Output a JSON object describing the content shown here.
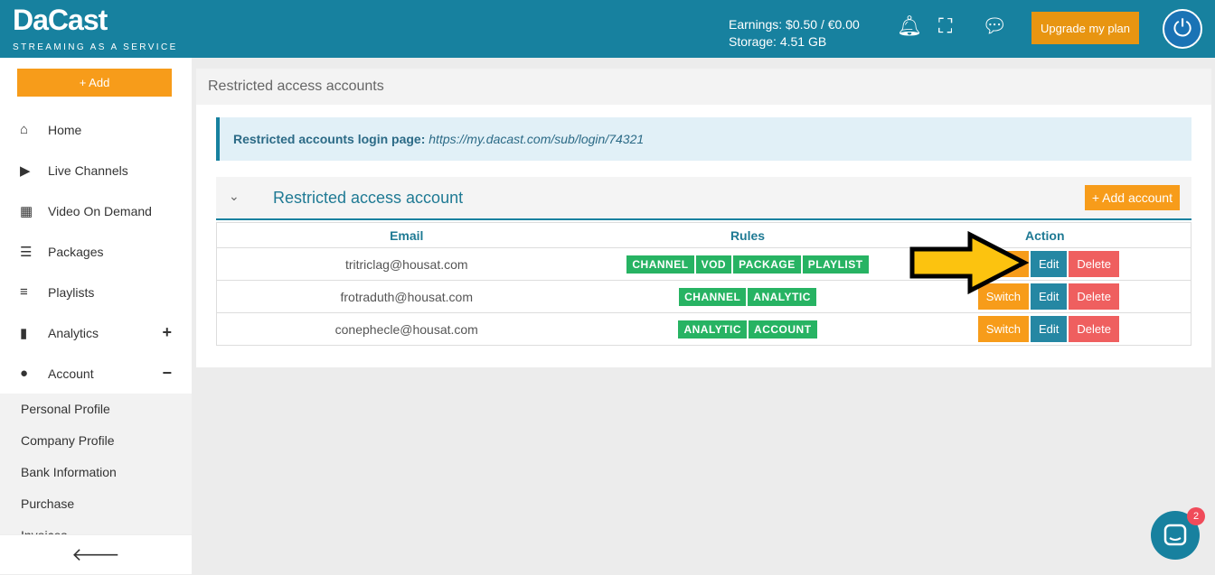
{
  "header": {
    "logo": "DaCast",
    "tagline": "STREAMING AS A SERVICE",
    "earnings": "Earnings: $0.50 / €0.00",
    "storage": "Storage: 4.51 GB",
    "upgrade": "Upgrade my plan"
  },
  "sidebar": {
    "add": "+ Add",
    "items": [
      {
        "label": "Home",
        "icon": "⌂"
      },
      {
        "label": "Live Channels",
        "icon": "▶"
      },
      {
        "label": "Video On Demand",
        "icon": "▦"
      },
      {
        "label": "Packages",
        "icon": "☰"
      },
      {
        "label": "Playlists",
        "icon": "≡"
      },
      {
        "label": "Analytics",
        "icon": "▮",
        "toggle": "+"
      },
      {
        "label": "Account",
        "icon": "●",
        "toggle": "−"
      }
    ],
    "subitems": [
      "Personal Profile",
      "Company Profile",
      "Bank Information",
      "Purchase",
      "Invoices"
    ],
    "back": "🡐"
  },
  "main": {
    "title": "Restricted access accounts",
    "info_label": "Restricted accounts login page:",
    "info_url": "https://my.dacast.com/sub/login/74321",
    "section_title": "Restricted access account",
    "add_account": "+ Add account",
    "columns": [
      "Email",
      "Rules",
      "Action"
    ],
    "rows": [
      {
        "email": "tritriclag@housat.com",
        "rules": [
          "CHANNEL",
          "VOD",
          "PACKAGE",
          "PLAYLIST"
        ]
      },
      {
        "email": "frotraduth@housat.com",
        "rules": [
          "CHANNEL",
          "ANALYTIC"
        ]
      },
      {
        "email": "conephecle@housat.com",
        "rules": [
          "ANALYTIC",
          "ACCOUNT"
        ]
      }
    ],
    "actions": {
      "switch": "Switch",
      "edit": "Edit",
      "delete": "Delete"
    }
  },
  "chat": {
    "badge": "2"
  },
  "colors": {
    "header": "#17819f",
    "accent": "#f79c1a",
    "rule": "#27b363",
    "edit": "#2587a3",
    "delete": "#ef5f5f",
    "arrow": "#fcc30f"
  }
}
